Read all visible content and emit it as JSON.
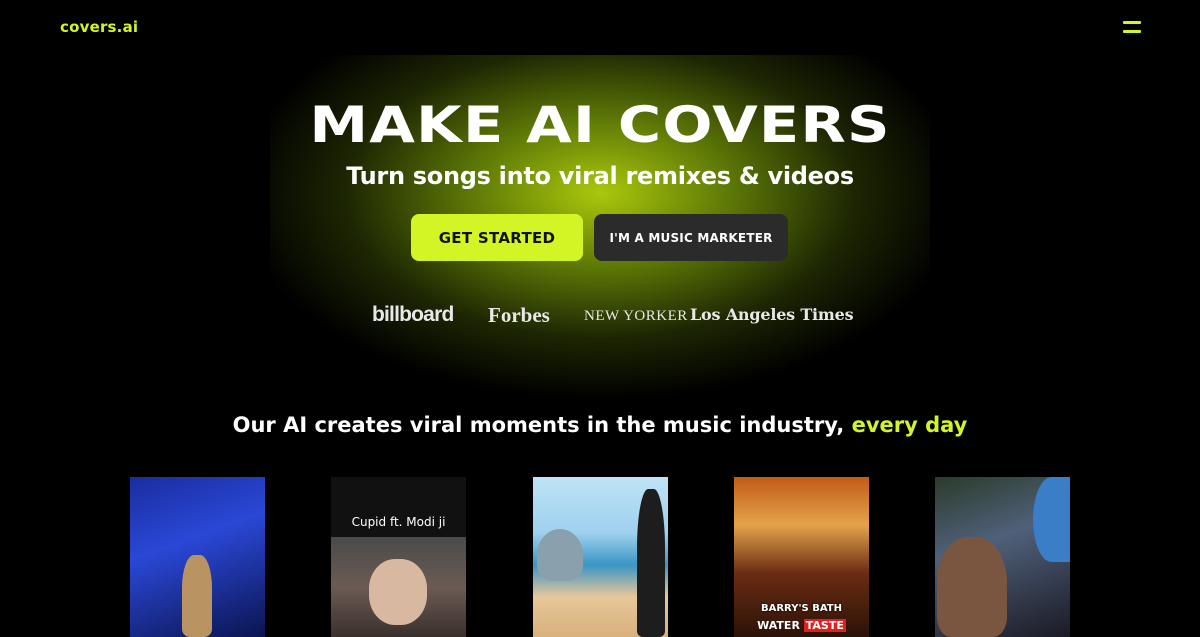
{
  "header": {
    "logo": "covers.ai",
    "menu_icon": "hamburger-icon"
  },
  "hero": {
    "title": "MAKE AI COVERS",
    "subtitle": "Turn songs into viral remixes & videos",
    "primary_cta": "GET STARTED",
    "secondary_cta": "I'M A MUSIC MARKETER"
  },
  "press": {
    "logos": [
      "billboard",
      "Forbes",
      "NEW YORKER",
      "Los Angeles Times"
    ]
  },
  "tagline": {
    "main": "Our AI creates viral moments in the music industry, ",
    "accent": "every day"
  },
  "videos": {
    "items": [
      {
        "caption": ""
      },
      {
        "caption": "Cupid ft. Modi ji"
      },
      {
        "caption": ""
      },
      {
        "caption_line1": "BARRY'S BATH",
        "caption_line2_a": "WATER ",
        "caption_line2_b": "TASTE"
      },
      {
        "caption": ""
      }
    ]
  },
  "colors": {
    "accent": "#d4f525",
    "background": "#000000",
    "secondary_button": "#2b2b2b"
  }
}
